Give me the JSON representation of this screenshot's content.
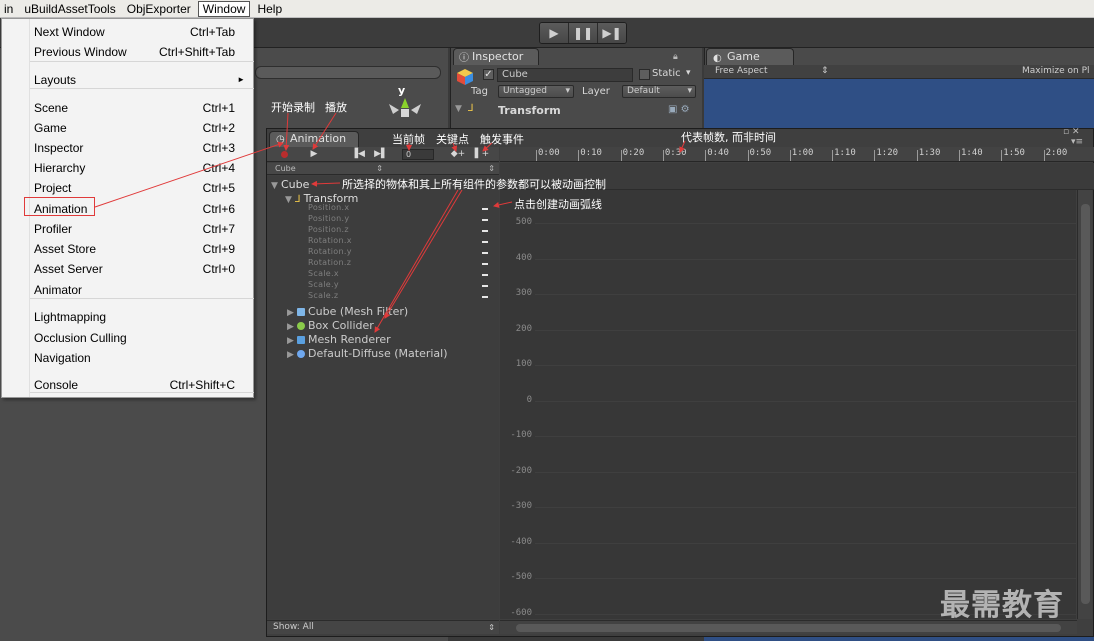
{
  "menubar": {
    "items": [
      "in",
      "uBuildAssetTools",
      "ObjExporter",
      "Window",
      "Help"
    ],
    "active": "Window"
  },
  "toolbar": {
    "play": "▶",
    "pause": "❚❚",
    "step": "▶❚"
  },
  "window_menu": {
    "items": [
      {
        "label": "Next Window",
        "shortcut": "Ctrl+Tab"
      },
      {
        "label": "Previous Window",
        "shortcut": "Ctrl+Shift+Tab"
      },
      {
        "label": "Layouts",
        "shortcut": "►"
      },
      {
        "label": "Scene",
        "shortcut": "Ctrl+1"
      },
      {
        "label": "Game",
        "shortcut": "Ctrl+2"
      },
      {
        "label": "Inspector",
        "shortcut": "Ctrl+3"
      },
      {
        "label": "Hierarchy",
        "shortcut": "Ctrl+4"
      },
      {
        "label": "Project",
        "shortcut": "Ctrl+5"
      },
      {
        "label": "Animation",
        "shortcut": "Ctrl+6"
      },
      {
        "label": "Profiler",
        "shortcut": "Ctrl+7"
      },
      {
        "label": "Asset Store",
        "shortcut": "Ctrl+9"
      },
      {
        "label": "Asset Server",
        "shortcut": "Ctrl+0"
      },
      {
        "label": "Animator",
        "shortcut": ""
      },
      {
        "label": "Lightmapping",
        "shortcut": ""
      },
      {
        "label": "Occlusion Culling",
        "shortcut": ""
      },
      {
        "label": "Navigation",
        "shortcut": ""
      },
      {
        "label": "Console",
        "shortcut": "Ctrl+Shift+C"
      }
    ],
    "highlighted": "Animation"
  },
  "scene": {
    "gizmo_axis": "y"
  },
  "inspector": {
    "tab": "Inspector",
    "object_name": "Cube",
    "static_label": "Static",
    "tag_label": "Tag",
    "tag_value": "Untagged",
    "layer_label": "Layer",
    "layer_value": "Default",
    "component": "Transform"
  },
  "game": {
    "tab": "Game",
    "aspect": "Free Aspect",
    "maximize": "Maximize on Pl"
  },
  "animation": {
    "tab": "Animation",
    "frame": "0",
    "clip": "Cube",
    "ruler": [
      "0:00",
      "0:10",
      "0:20",
      "0:30",
      "0:40",
      "0:50",
      "1:00",
      "1:10",
      "1:20",
      "1:30",
      "1:40",
      "1:50",
      "2:00"
    ],
    "y_axis": [
      "500",
      "400",
      "300",
      "200",
      "100",
      "0",
      "-100",
      "-200",
      "-300",
      "-400",
      "-500",
      "-600"
    ],
    "root": "Cube",
    "transform": "Transform",
    "properties": [
      "Position.x",
      "Position.y",
      "Position.z",
      "Rotation.x",
      "Rotation.y",
      "Rotation.z",
      "Scale.x",
      "Scale.y",
      "Scale.z"
    ],
    "components": [
      "Cube (Mesh Filter)",
      "Box Collider",
      "Mesh Renderer",
      "Default-Diffuse (Material)"
    ],
    "show": "Show: All"
  },
  "annotations": {
    "record": "开始录制",
    "play": "播放",
    "current_frame": "当前帧",
    "keyframe": "关键点",
    "event": "触发事件",
    "ruler_note": "代表帧数, 而非时间",
    "objects_note": "所选择的物体和其上所有组件的参数都可以被动画控制",
    "curve_note": "点击创建动画弧线"
  },
  "watermark": "最需教育",
  "colors": {
    "highlight": "#e03a3a",
    "game_bg": "#2f4f85",
    "record": "#b92d2d"
  }
}
